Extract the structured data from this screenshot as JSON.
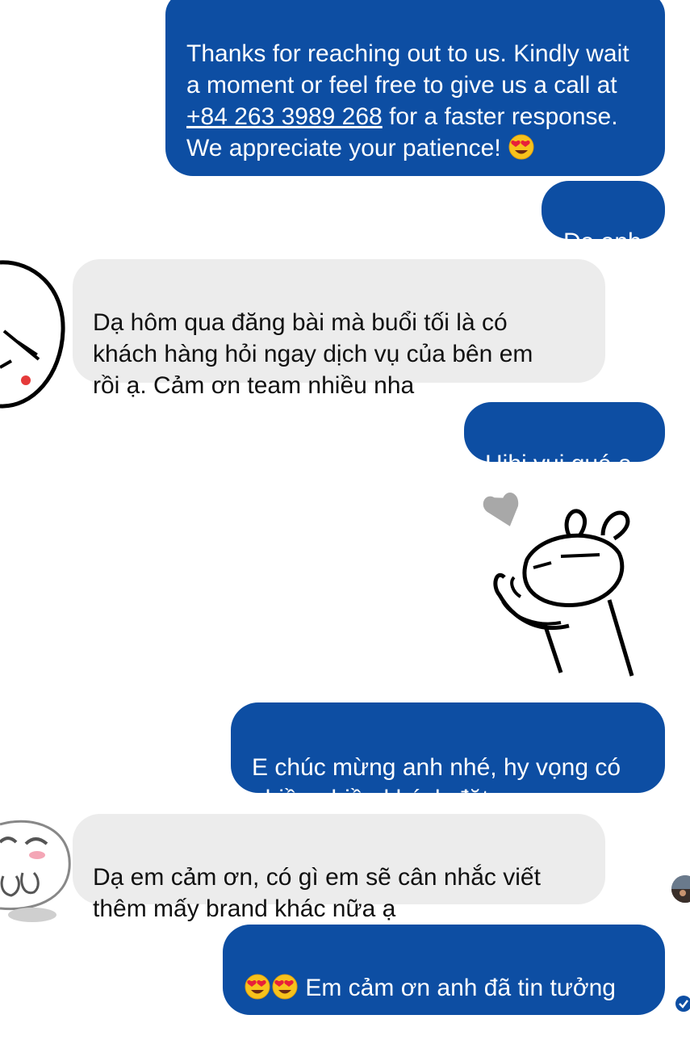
{
  "messages": [
    {
      "id": "auto_reply",
      "direction": "outgoing",
      "text_before": "Thanks for reaching out to us. Kindly wait a moment or feel free to give us a call at ",
      "phone": "+84 263 3989 268",
      "text_after": " for a faster response. We appreciate your patience! ",
      "emoji": "smiling-face-with-heart-eyes"
    },
    {
      "id": "m1",
      "direction": "outgoing",
      "text": "Dạ anh"
    },
    {
      "id": "m2",
      "direction": "incoming",
      "text": "Dạ hôm qua đăng bài mà buổi tối là có\nkhách hàng hỏi ngay dịch vụ của bên em\nrồi ạ. Cảm ơn team nhiều nha"
    },
    {
      "id": "m3",
      "direction": "outgoing",
      "text": "Hihi vui quá ạ"
    },
    {
      "id": "sticker1",
      "direction": "outgoing",
      "sticker": "bunny-with-heart-sticker"
    },
    {
      "id": "m4",
      "direction": "outgoing",
      "text": "E chúc mừng anh nhé, hy vọng có\nnhiều nhiều khách đặt ạ"
    },
    {
      "id": "m5",
      "direction": "incoming",
      "text": "Dạ em cảm ơn, có gì em sẽ cân nhắc viết\nthêm mấy brand khác nữa ạ"
    },
    {
      "id": "m6",
      "direction": "outgoing",
      "text": "Em cảm ơn anh đã tin tưởng\nTGROUP ạ",
      "emoji": "smiling-face-with-heart-eyes"
    }
  ],
  "colors": {
    "outgoing_bubble": "#0d4ea3",
    "incoming_bubble": "#ececec",
    "seen_check": "#0d4ea3"
  },
  "icons": [
    "face-sticker-icon",
    "blush-face-sticker-icon",
    "seen-avatar-icon",
    "delivered-check-icon"
  ]
}
